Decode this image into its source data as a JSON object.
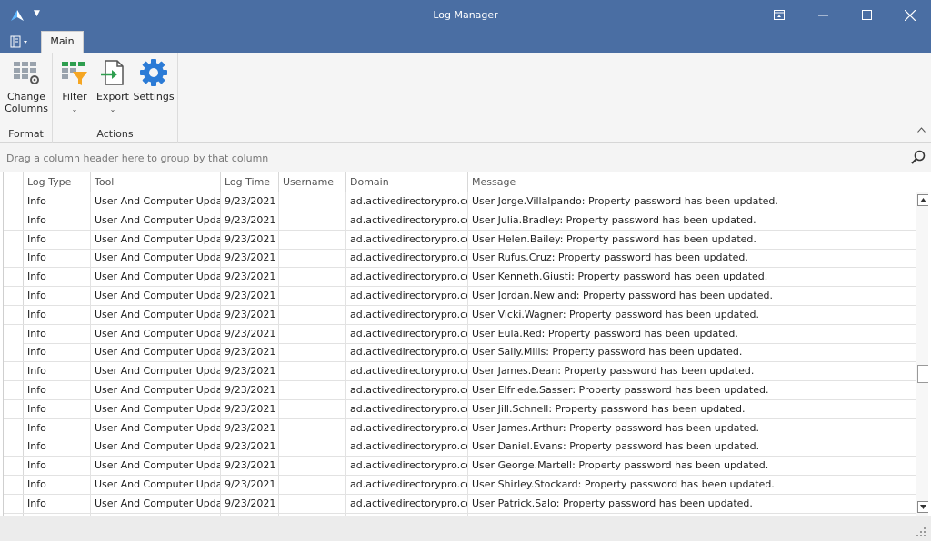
{
  "window": {
    "title": "Log Manager"
  },
  "ribbon": {
    "tab_main": "Main",
    "groups": {
      "format": {
        "label": "Format",
        "change_columns_line1": "Change",
        "change_columns_line2": "Columns"
      },
      "actions": {
        "label": "Actions",
        "filter": "Filter",
        "export": "Export",
        "settings": "Settings"
      }
    }
  },
  "groupbar": {
    "hint": "Drag a column header here to group by that column"
  },
  "grid": {
    "columns": [
      "Log Type",
      "Tool",
      "Log Time",
      "Username",
      "Domain",
      "Message"
    ],
    "rows": [
      {
        "log_type": "Info",
        "tool": "User And Computer Updater",
        "log_time": "9/23/2021",
        "username": "",
        "domain": "ad.activedirectorypro.com",
        "message": "User Jorge.Villalpando: Property password has been updated."
      },
      {
        "log_type": "Info",
        "tool": "User And Computer Updater",
        "log_time": "9/23/2021",
        "username": "",
        "domain": "ad.activedirectorypro.com",
        "message": "User Julia.Bradley: Property password has been updated."
      },
      {
        "log_type": "Info",
        "tool": "User And Computer Updater",
        "log_time": "9/23/2021",
        "username": "",
        "domain": "ad.activedirectorypro.com",
        "message": "User Helen.Bailey: Property password has been updated."
      },
      {
        "log_type": "Info",
        "tool": "User And Computer Updater",
        "log_time": "9/23/2021",
        "username": "",
        "domain": "ad.activedirectorypro.com",
        "message": "User Rufus.Cruz: Property password has been updated."
      },
      {
        "log_type": "Info",
        "tool": "User And Computer Updater",
        "log_time": "9/23/2021",
        "username": "",
        "domain": "ad.activedirectorypro.com",
        "message": "User Kenneth.Giusti: Property password has been updated."
      },
      {
        "log_type": "Info",
        "tool": "User And Computer Updater",
        "log_time": "9/23/2021",
        "username": "",
        "domain": "ad.activedirectorypro.com",
        "message": "User Jordan.Newland: Property password has been updated."
      },
      {
        "log_type": "Info",
        "tool": "User And Computer Updater",
        "log_time": "9/23/2021",
        "username": "",
        "domain": "ad.activedirectorypro.com",
        "message": "User Vicki.Wagner: Property password has been updated."
      },
      {
        "log_type": "Info",
        "tool": "User And Computer Updater",
        "log_time": "9/23/2021",
        "username": "",
        "domain": "ad.activedirectorypro.com",
        "message": "User Eula.Red: Property password has been updated."
      },
      {
        "log_type": "Info",
        "tool": "User And Computer Updater",
        "log_time": "9/23/2021",
        "username": "",
        "domain": "ad.activedirectorypro.com",
        "message": "User Sally.Mills: Property password has been updated."
      },
      {
        "log_type": "Info",
        "tool": "User And Computer Updater",
        "log_time": "9/23/2021",
        "username": "",
        "domain": "ad.activedirectorypro.com",
        "message": "User James.Dean: Property password has been updated."
      },
      {
        "log_type": "Info",
        "tool": "User And Computer Updater",
        "log_time": "9/23/2021",
        "username": "",
        "domain": "ad.activedirectorypro.com",
        "message": "User Elfriede.Sasser: Property password has been updated."
      },
      {
        "log_type": "Info",
        "tool": "User And Computer Updater",
        "log_time": "9/23/2021",
        "username": "",
        "domain": "ad.activedirectorypro.com",
        "message": "User Jill.Schnell: Property password has been updated."
      },
      {
        "log_type": "Info",
        "tool": "User And Computer Updater",
        "log_time": "9/23/2021",
        "username": "",
        "domain": "ad.activedirectorypro.com",
        "message": "User James.Arthur: Property password has been updated."
      },
      {
        "log_type": "Info",
        "tool": "User And Computer Updater",
        "log_time": "9/23/2021",
        "username": "",
        "domain": "ad.activedirectorypro.com",
        "message": "User Daniel.Evans: Property password has been updated."
      },
      {
        "log_type": "Info",
        "tool": "User And Computer Updater",
        "log_time": "9/23/2021",
        "username": "",
        "domain": "ad.activedirectorypro.com",
        "message": "User George.Martell: Property password has been updated."
      },
      {
        "log_type": "Info",
        "tool": "User And Computer Updater",
        "log_time": "9/23/2021",
        "username": "",
        "domain": "ad.activedirectorypro.com",
        "message": "User Shirley.Stockard: Property password has been updated."
      },
      {
        "log_type": "Info",
        "tool": "User And Computer Updater",
        "log_time": "9/23/2021",
        "username": "",
        "domain": "ad.activedirectorypro.com",
        "message": "User Patrick.Salo: Property password has been updated."
      }
    ]
  },
  "colors": {
    "titlebar": "#4a6ea3",
    "ribbon": "#f5f5f5",
    "accent_blue": "#2b7bd6",
    "filter_orange": "#f5a623",
    "export_green": "#2e9e4f"
  },
  "icons": {
    "app": "app-logo-icon",
    "restore_layout": "ribbon-display-options-icon",
    "minimize": "minimize-icon",
    "maximize": "maximize-icon",
    "close": "close-icon",
    "search": "search-icon",
    "change_columns": "change-columns-icon",
    "filter": "filter-icon",
    "export": "export-icon",
    "settings": "gear-icon"
  }
}
